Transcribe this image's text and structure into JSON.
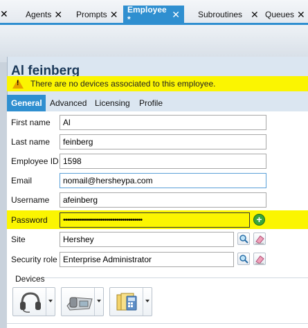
{
  "tabs": [
    {
      "label": "Agents",
      "close": "✕"
    },
    {
      "label": "Prompts",
      "close": "✕"
    },
    {
      "label": "Employee *",
      "close": "✕"
    },
    {
      "label": "Subroutines",
      "close": "✕"
    },
    {
      "label": "Queues",
      "close": "✕"
    }
  ],
  "left_close": "✕",
  "employee_name": "Al feinberg",
  "warning_text": "There are no devices associated to this employee.",
  "subtabs": [
    "General",
    "Advanced",
    "Licensing",
    "Profile"
  ],
  "form": {
    "first_name": {
      "label": "First name",
      "value": "Al"
    },
    "last_name": {
      "label": "Last name",
      "value": "feinberg"
    },
    "employee_id": {
      "label": "Employee ID",
      "value": "1598"
    },
    "email": {
      "label": "Email",
      "value": "nomail@hersheypa.com"
    },
    "username": {
      "label": "Username",
      "value": "afeinberg"
    },
    "password": {
      "label": "Password",
      "value": "••••••••••••••••••••••••••••••••••••••••"
    },
    "site": {
      "label": "Site",
      "value": "Hershey"
    },
    "security_role": {
      "label": "Security role",
      "value": "Enterprise Administrator"
    }
  },
  "devices_label": "Devices",
  "colors": {
    "accent": "#2f8fd0",
    "highlight": "#fbf501",
    "add": "#3aa63a"
  }
}
